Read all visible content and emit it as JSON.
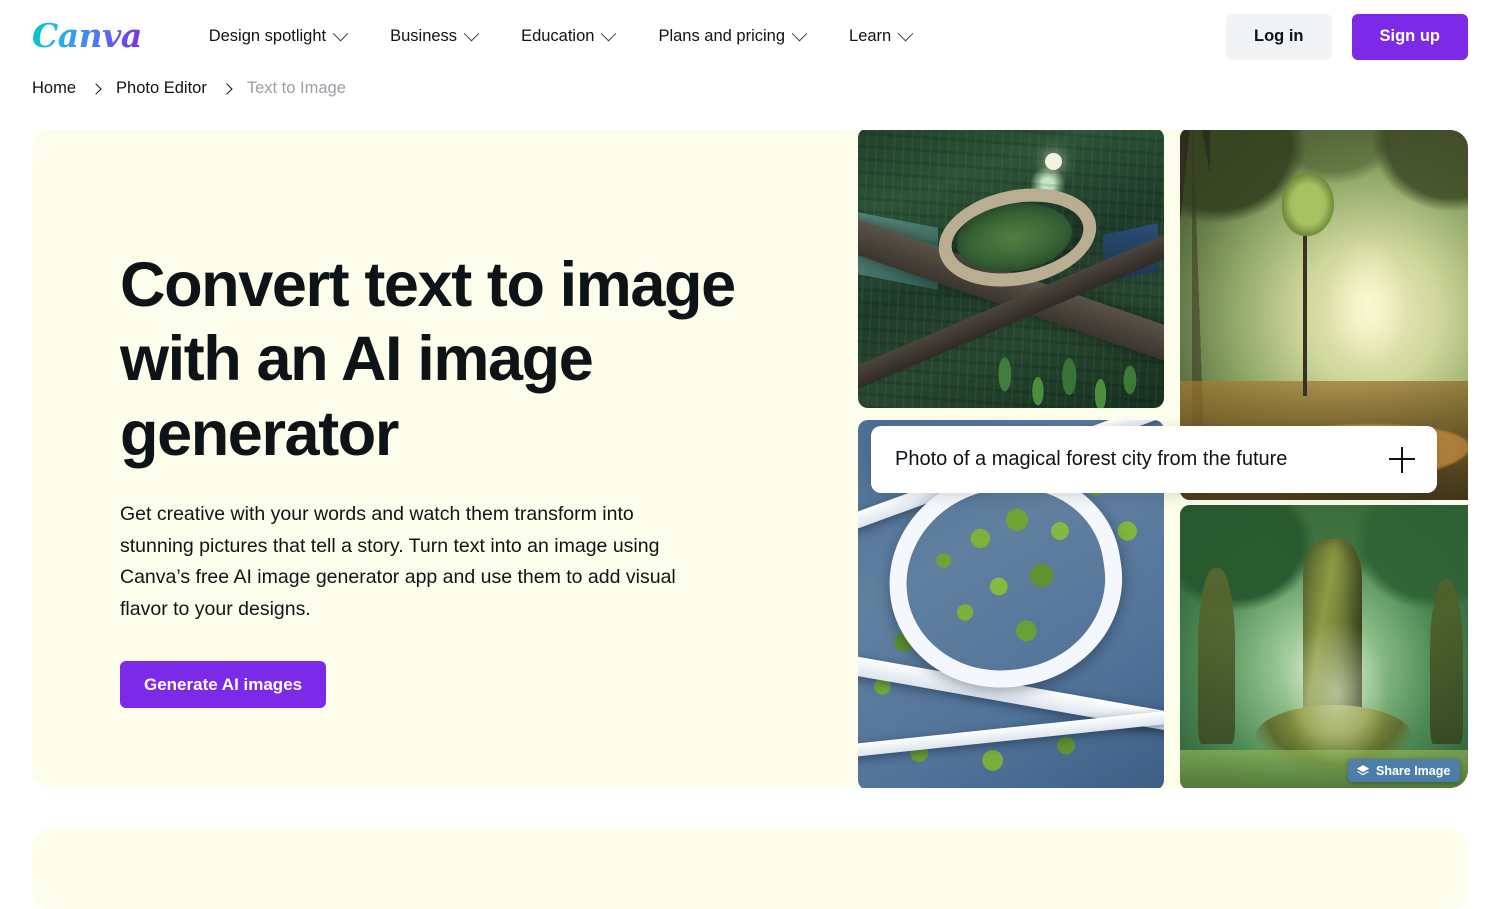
{
  "header": {
    "logo_text": "Canva",
    "nav": [
      {
        "label": "Design spotlight",
        "icon": "chevron-down-icon"
      },
      {
        "label": "Business",
        "icon": "chevron-down-icon"
      },
      {
        "label": "Education",
        "icon": "chevron-down-icon"
      },
      {
        "label": "Plans and pricing",
        "icon": "chevron-down-icon"
      },
      {
        "label": "Learn",
        "icon": "chevron-down-icon"
      }
    ],
    "login_label": "Log in",
    "signup_label": "Sign up"
  },
  "breadcrumb": {
    "items": [
      {
        "label": "Home",
        "active": true
      },
      {
        "label": "Photo Editor",
        "active": true
      },
      {
        "label": "Text to Image",
        "active": false
      }
    ]
  },
  "hero": {
    "title": "Convert text to image with an AI image generator",
    "subtitle": "Get creative with your words and watch them transform into stunning pictures that tell a story. Turn text into an image using Canva’s free AI image generator app and use them to add visual flavor to your designs.",
    "cta_label": "Generate AI images",
    "background_color": "#fcfdea"
  },
  "prompt": {
    "value": "Photo of a magical forest city from the future",
    "add_icon": "plus-icon"
  },
  "gallery": {
    "images": [
      {
        "alt": "Aerial view of a green futuristic city with elevated ring road"
      },
      {
        "alt": "Sunlit misty forest with tall trees and golden pathways"
      },
      {
        "alt": "Aerial view of white curving highways looping around green trees"
      },
      {
        "alt": "Giant ancient tree with massive trunk in a glowing green forest"
      }
    ]
  },
  "share_badge": {
    "label": "Share Image",
    "icon": "layers-icon",
    "color": "#4a7cb7"
  },
  "colors": {
    "brand_purple": "#7d2ae8",
    "logo_gradient_start": "#00c4cc",
    "logo_gradient_end": "#7d2ae8",
    "hero_cream": "#fcfdea",
    "text_dark": "#0e1318",
    "text_muted": "#9ba0a6"
  }
}
